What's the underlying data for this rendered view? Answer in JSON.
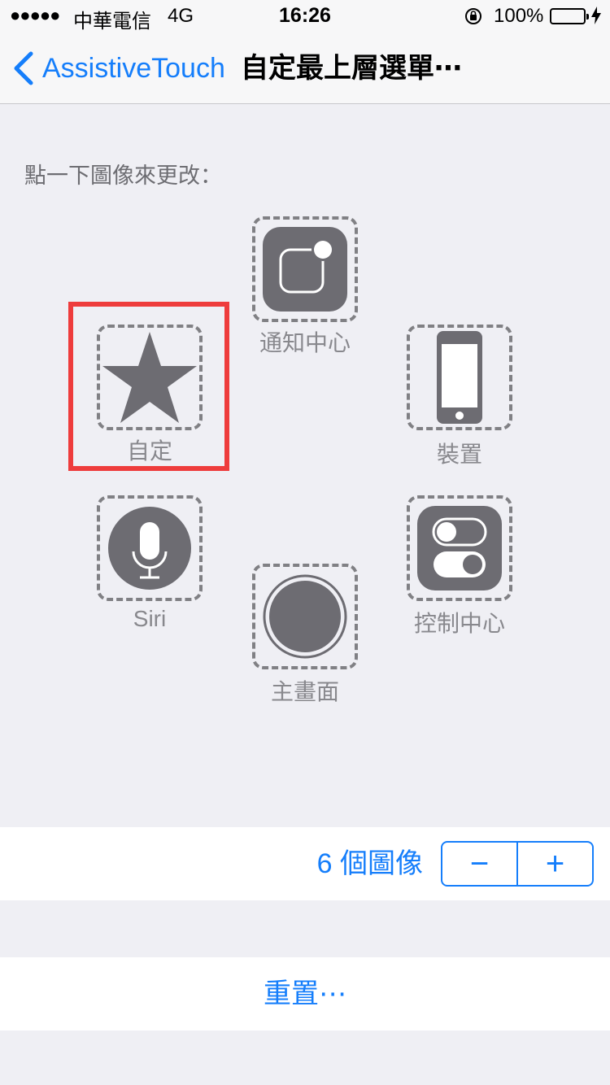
{
  "status_bar": {
    "signal": "●●●●●",
    "carrier": "中華電信",
    "network": "4G",
    "time": "16:26",
    "battery": "100%"
  },
  "nav": {
    "back_label": "AssistiveTouch",
    "title": "自定最上層選單⋯"
  },
  "instruction": "點一下圖像來更改：",
  "slots": {
    "notification_center": "通知中心",
    "custom": "自定",
    "device": "裝置",
    "siri": "Siri",
    "control_center": "控制中心",
    "home": "主畫面"
  },
  "stepper": {
    "count_label": "6 個圖像",
    "minus": "−",
    "plus": "+"
  },
  "reset_label": "重置⋯",
  "colors": {
    "accent": "#157efb",
    "highlight": "#ee3c3c",
    "icon_fill": "#6d6c72",
    "background": "#efeff4"
  }
}
